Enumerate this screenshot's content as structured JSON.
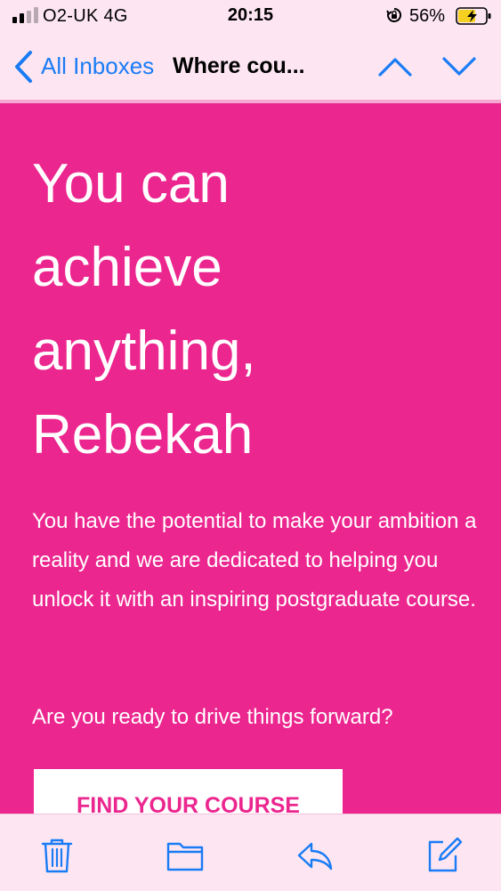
{
  "status_bar": {
    "carrier": "O2-UK  4G",
    "time": "20:15",
    "battery_percent": "56%",
    "signal_bars": 2,
    "icons": [
      "signal-icon",
      "orientation-lock-icon",
      "battery-charging-icon"
    ]
  },
  "nav": {
    "back_label": "All Inboxes",
    "subject": "Where cou...",
    "icons": [
      "back-chevron-icon",
      "previous-message-icon",
      "next-message-icon"
    ]
  },
  "email": {
    "headline": [
      "You can",
      "achieve",
      "anything,",
      "Rebekah"
    ],
    "intro": "You have the potential to make your ambition a reality and we are dedicated to helping you unlock it with an inspiring postgraduate course.",
    "question": "Are you ready to drive things forward?",
    "cta_label": "FIND YOUR COURSE"
  },
  "toolbar": {
    "icons": [
      "trash-icon",
      "folder-icon",
      "reply-icon",
      "compose-icon"
    ]
  },
  "colors": {
    "accent": "#1a7cf5",
    "email_background": "#ec268f",
    "chrome_background": "#fde6f2",
    "battery_charging": "#f5d020"
  }
}
